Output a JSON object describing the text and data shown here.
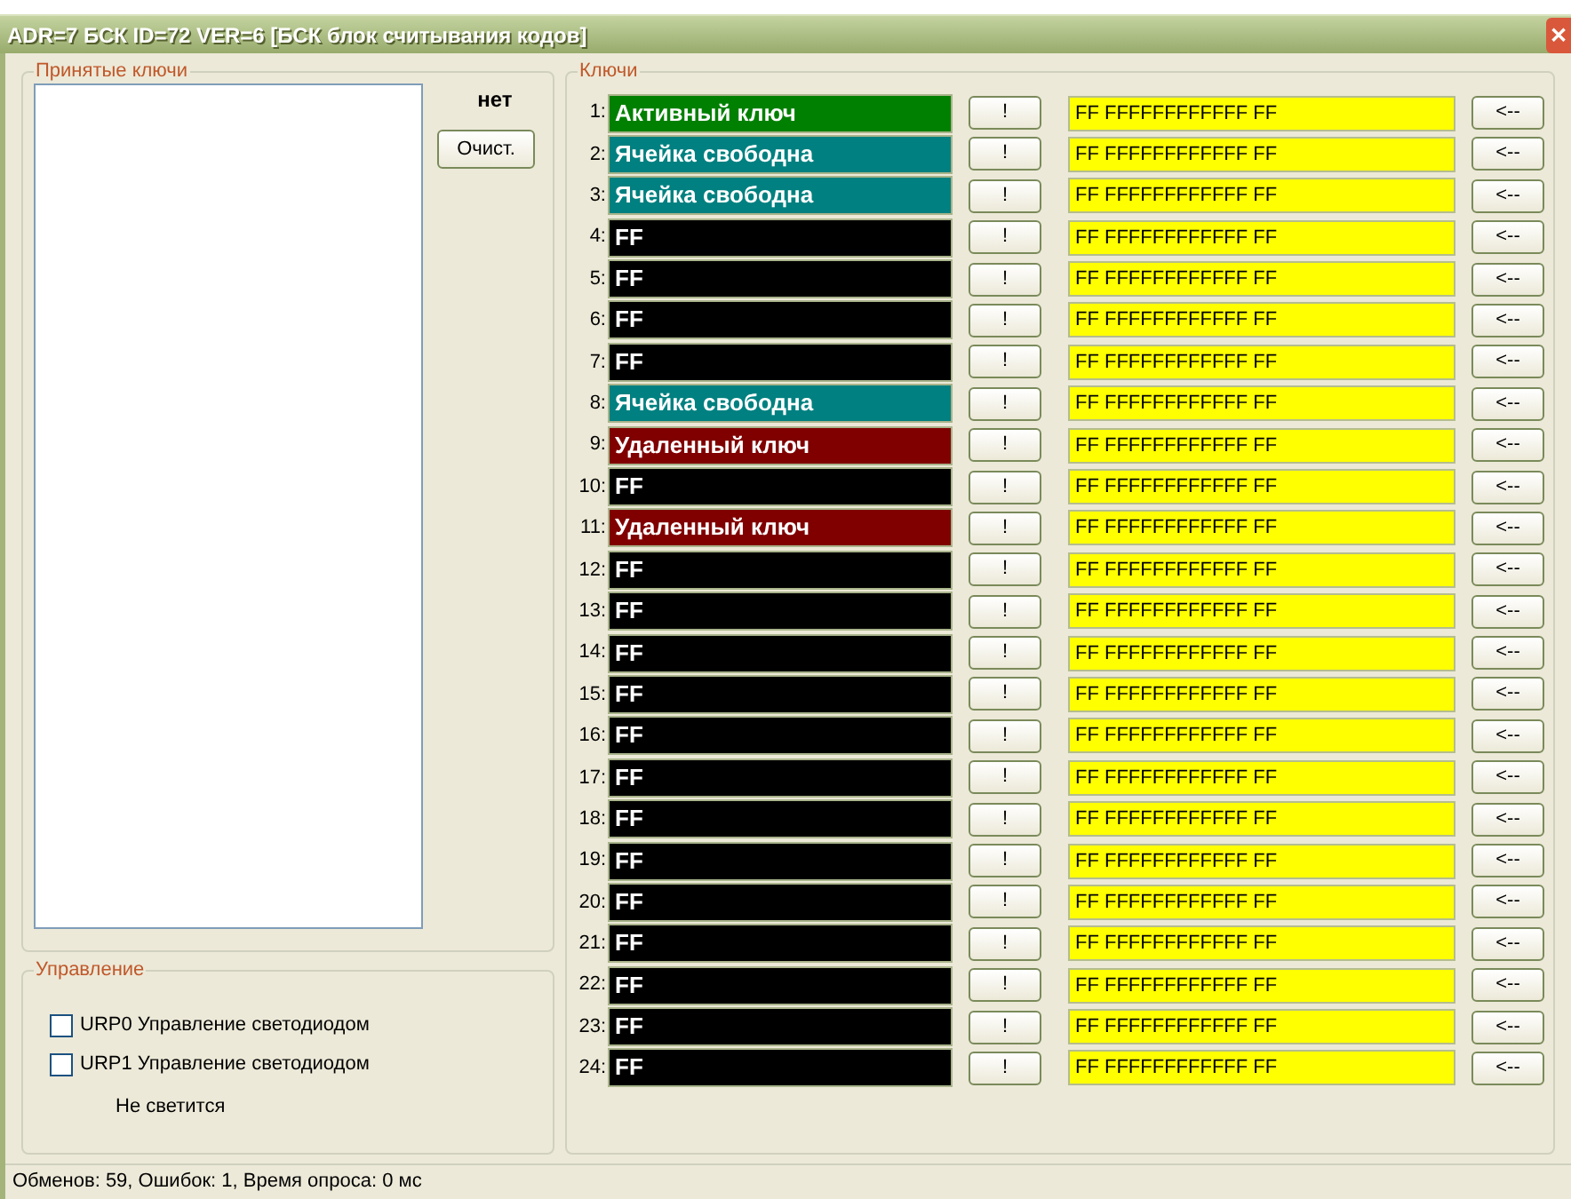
{
  "window": {
    "title": "ADR=7 БСК ID=72 VER=6 [БСК блок считывания кодов]",
    "close": "✕"
  },
  "received": {
    "title": "Принятые ключи",
    "status": "нет",
    "clear_button": "Очист."
  },
  "control": {
    "title": "Управление",
    "checkboxes": [
      {
        "label": "URP0 Управление светодиодом",
        "checked": false
      },
      {
        "label": "URP1 Управление светодиодом",
        "checked": false
      }
    ],
    "state": "Не светится"
  },
  "keys": {
    "title": "Ключи",
    "rows": [
      {
        "number": "1:",
        "kind": "active",
        "value": "Активный ключ",
        "button": "!",
        "code": "FF FFFFFFFFFFFF FF",
        "load_button": "<--"
      },
      {
        "number": "2:",
        "kind": "free",
        "value": "Ячейка свободна",
        "button": "!",
        "code": "FF FFFFFFFFFFFF FF",
        "load_button": "<--"
      },
      {
        "number": "3:",
        "kind": "free",
        "value": "Ячейка свободна",
        "button": "!",
        "code": "FF FFFFFFFFFFFF FF",
        "load_button": "<--"
      },
      {
        "number": "4:",
        "kind": "raw",
        "value": "FF",
        "button": "!",
        "code": "FF FFFFFFFFFFFF FF",
        "load_button": "<--"
      },
      {
        "number": "5:",
        "kind": "raw",
        "value": "FF",
        "button": "!",
        "code": "FF FFFFFFFFFFFF FF",
        "load_button": "<--"
      },
      {
        "number": "6:",
        "kind": "raw",
        "value": "FF",
        "button": "!",
        "code": "FF FFFFFFFFFFFF FF",
        "load_button": "<--"
      },
      {
        "number": "7:",
        "kind": "raw",
        "value": "FF",
        "button": "!",
        "code": "FF FFFFFFFFFFFF FF",
        "load_button": "<--"
      },
      {
        "number": "8:",
        "kind": "free",
        "value": "Ячейка свободна",
        "button": "!",
        "code": "FF FFFFFFFFFFFF FF",
        "load_button": "<--"
      },
      {
        "number": "9:",
        "kind": "deleted",
        "value": "Удаленный ключ",
        "button": "!",
        "code": "FF FFFFFFFFFFFF FF",
        "load_button": "<--"
      },
      {
        "number": "10:",
        "kind": "raw",
        "value": "FF",
        "button": "!",
        "code": "FF FFFFFFFFFFFF FF",
        "load_button": "<--"
      },
      {
        "number": "11:",
        "kind": "deleted",
        "value": "Удаленный ключ",
        "button": "!",
        "code": "FF FFFFFFFFFFFF FF",
        "load_button": "<--"
      },
      {
        "number": "12:",
        "kind": "raw",
        "value": "FF",
        "button": "!",
        "code": "FF FFFFFFFFFFFF FF",
        "load_button": "<--"
      },
      {
        "number": "13:",
        "kind": "raw",
        "value": "FF",
        "button": "!",
        "code": "FF FFFFFFFFFFFF FF",
        "load_button": "<--"
      },
      {
        "number": "14:",
        "kind": "raw",
        "value": "FF",
        "button": "!",
        "code": "FF FFFFFFFFFFFF FF",
        "load_button": "<--"
      },
      {
        "number": "15:",
        "kind": "raw",
        "value": "FF",
        "button": "!",
        "code": "FF FFFFFFFFFFFF FF",
        "load_button": "<--"
      },
      {
        "number": "16:",
        "kind": "raw",
        "value": "FF",
        "button": "!",
        "code": "FF FFFFFFFFFFFF FF",
        "load_button": "<--"
      },
      {
        "number": "17:",
        "kind": "raw",
        "value": "FF",
        "button": "!",
        "code": "FF FFFFFFFFFFFF FF",
        "load_button": "<--"
      },
      {
        "number": "18:",
        "kind": "raw",
        "value": "FF",
        "button": "!",
        "code": "FF FFFFFFFFFFFF FF",
        "load_button": "<--"
      },
      {
        "number": "19:",
        "kind": "raw",
        "value": "FF",
        "button": "!",
        "code": "FF FFFFFFFFFFFF FF",
        "load_button": "<--"
      },
      {
        "number": "20:",
        "kind": "raw",
        "value": "FF",
        "button": "!",
        "code": "FF FFFFFFFFFFFF FF",
        "load_button": "<--"
      },
      {
        "number": "21:",
        "kind": "raw",
        "value": "FF",
        "button": "!",
        "code": "FF FFFFFFFFFFFF FF",
        "load_button": "<--"
      },
      {
        "number": "22:",
        "kind": "raw",
        "value": "FF",
        "button": "!",
        "code": "FF FFFFFFFFFFFF FF",
        "load_button": "<--"
      },
      {
        "number": "23:",
        "kind": "raw",
        "value": "FF",
        "button": "!",
        "code": "FF FFFFFFFFFFFF FF",
        "load_button": "<--"
      },
      {
        "number": "24:",
        "kind": "raw",
        "value": "FF",
        "button": "!",
        "code": "FF FFFFFFFFFFFF FF",
        "load_button": "<--"
      }
    ]
  },
  "status_bar": "Обменов: 59, Ошибок: 1, Время опроса: 0 мс"
}
